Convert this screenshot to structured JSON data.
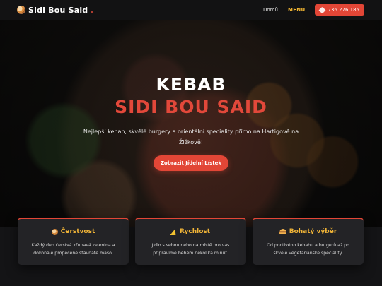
{
  "nav": {
    "brand": "Sidi Bou Said",
    "links": [
      "Domů",
      "MENU"
    ],
    "phone": "736 276 185"
  },
  "hero": {
    "title_line1": "KEBAB",
    "title_line2": "SIDI BOU SAID",
    "subtitle": "Nejlepší kebab, skvělé burgery a orientální speciality přímo na Hartigově na Žižkově!",
    "cta": "Zobrazit Jídelní Lístek"
  },
  "features": [
    {
      "icon": "bread-icon",
      "title": "Čerstvost",
      "text": "Každý den čerstvá křupavá zelenina a dokonale propečené šťavnaté maso."
    },
    {
      "icon": "lightning-icon",
      "title": "Rychlost",
      "text": "Jídlo s sebou nebo na místě pro vás připravíme během několika minut."
    },
    {
      "icon": "burger-icon",
      "title": "Bohatý výběr",
      "text": "Od poctivého kebabu a burgerů až po skvělé vegetariánské speciality."
    }
  ],
  "colors": {
    "accent": "#e24636",
    "gold": "#f0b437",
    "background": "#0f0f10",
    "card": "#232326"
  }
}
